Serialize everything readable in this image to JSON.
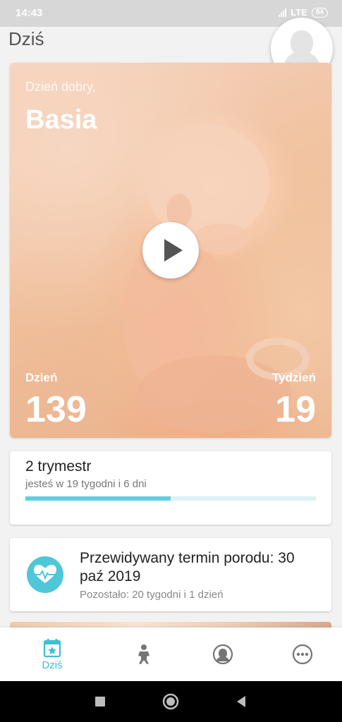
{
  "status_bar": {
    "time": "14:43",
    "network": "LTE",
    "battery": "84"
  },
  "header": {
    "title": "Dziś"
  },
  "hero": {
    "greeting": "Dzień dobry,",
    "name": "Basia",
    "day_label": "Dzień",
    "day_value": "139",
    "week_label": "Tydzień",
    "week_value": "19"
  },
  "trimester_card": {
    "title": "2 trymestr",
    "subtitle": "jesteś w 19 tygodni i 6 dni",
    "progress": 0.5
  },
  "due_card": {
    "title": "Przewidywany termin porodu: 30 paź 2019",
    "subtitle": "Pozostało: 20 tygodni i 1 dzień"
  },
  "bottom_nav": {
    "items": [
      {
        "label": "Dziś",
        "icon": "calendar-star-icon",
        "active": true
      },
      {
        "label": "",
        "icon": "baby-icon",
        "active": false
      },
      {
        "label": "",
        "icon": "mother-profile-icon",
        "active": false
      },
      {
        "label": "",
        "icon": "more-icon",
        "active": false
      }
    ]
  },
  "colors": {
    "accent": "#4ec7d8",
    "progress_track": "#dcf2f6",
    "progress_fill": "#5cd0df"
  }
}
